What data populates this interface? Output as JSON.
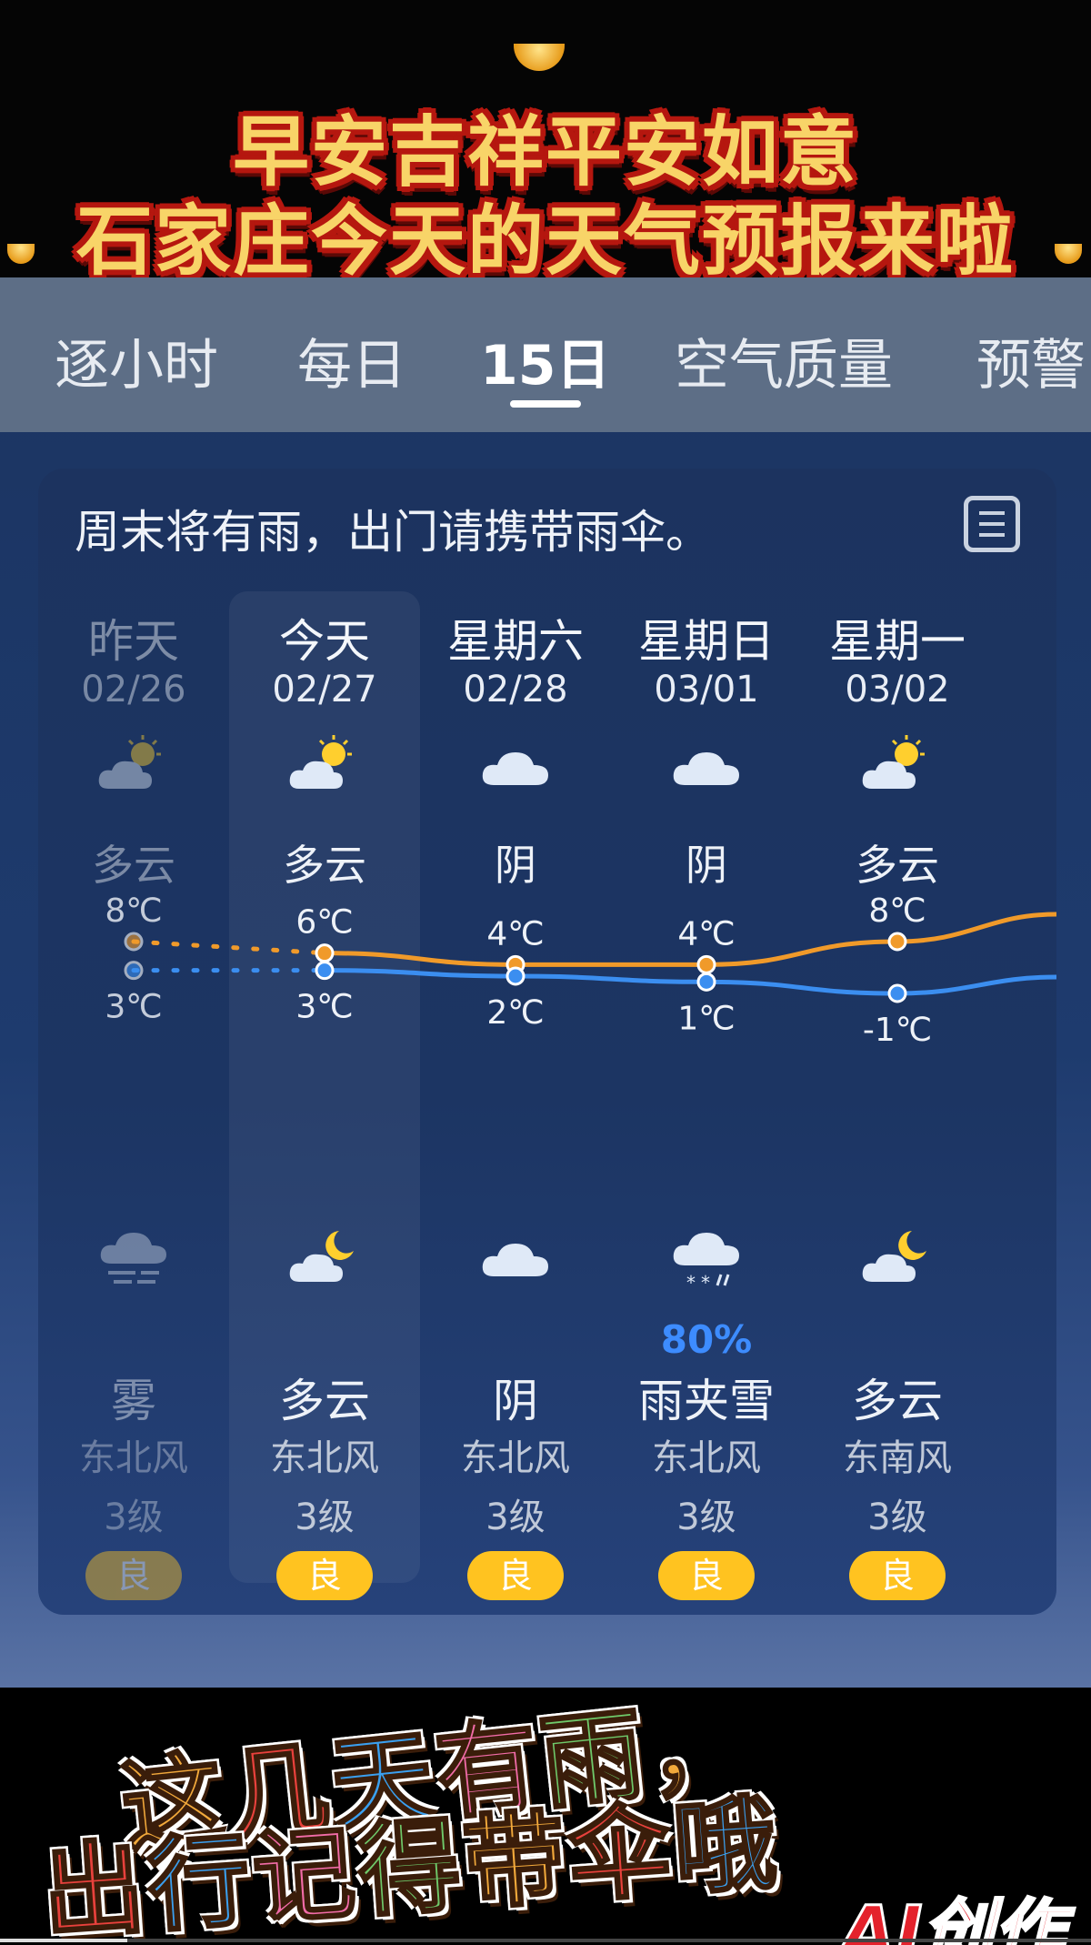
{
  "banner": {
    "line1": "早安吉祥平安如意",
    "line2": "石家庄今天的天气预报来啦"
  },
  "tabs": [
    {
      "label": "逐小时"
    },
    {
      "label": "每日"
    },
    {
      "label": "15日",
      "active": true
    },
    {
      "label": "空气质量"
    },
    {
      "label": "预警"
    }
  ],
  "card": {
    "summary": "周末将有雨，出门请携带雨伞。",
    "days": [
      {
        "name": "昨天",
        "date": "02/26",
        "day_icon": "partly-cloudy-day-icon",
        "day_cond": "多云",
        "high": "8℃",
        "low": "3℃",
        "night_icon": "fog-icon",
        "precip": "",
        "night_cond": "雾",
        "wind": "东北风",
        "level": "3级",
        "aqi": "良"
      },
      {
        "name": "今天",
        "date": "02/27",
        "day_icon": "partly-cloudy-day-icon",
        "day_cond": "多云",
        "high": "6℃",
        "low": "3℃",
        "night_icon": "partly-cloudy-night-icon",
        "precip": "",
        "night_cond": "多云",
        "wind": "东北风",
        "level": "3级",
        "aqi": "良"
      },
      {
        "name": "星期六",
        "date": "02/28",
        "day_icon": "cloud-icon",
        "day_cond": "阴",
        "high": "4℃",
        "low": "2℃",
        "night_icon": "cloud-icon",
        "precip": "",
        "night_cond": "阴",
        "wind": "东北风",
        "level": "3级",
        "aqi": "良"
      },
      {
        "name": "星期日",
        "date": "03/01",
        "day_icon": "cloud-icon",
        "day_cond": "阴",
        "high": "4℃",
        "low": "1℃",
        "night_icon": "sleet-icon",
        "precip": "80%",
        "night_cond": "雨夹雪",
        "wind": "东北风",
        "level": "3级",
        "aqi": "良"
      },
      {
        "name": "星期一",
        "date": "03/02",
        "day_icon": "partly-cloudy-day-icon",
        "day_cond": "多云",
        "high": "8℃",
        "low": "-1℃",
        "night_icon": "partly-cloudy-night-icon",
        "precip": "",
        "night_cond": "多云",
        "wind": "东南风",
        "level": "3级",
        "aqi": "良"
      }
    ]
  },
  "chart_data": {
    "type": "line",
    "x": [
      "02/26",
      "02/27",
      "02/28",
      "03/01",
      "03/02"
    ],
    "series": [
      {
        "values": [
          8,
          6,
          4,
          4,
          8
        ],
        "color": "#f09a2a"
      },
      {
        "values": [
          3,
          3,
          2,
          1,
          -1
        ],
        "color": "#3b8ef0"
      }
    ],
    "ylim": [
      -1,
      8
    ]
  },
  "overlay": {
    "line1": [
      "这",
      "几",
      "天",
      "有",
      "雨",
      "，"
    ],
    "line2": [
      "出",
      "行",
      "记",
      "得",
      "带",
      "伞",
      "哦"
    ],
    "brand": "AI创作",
    "colors": [
      "#f2a93b",
      "#e8413c",
      "#3aa0f0",
      "#f26ca8",
      "#6fc96a"
    ]
  }
}
